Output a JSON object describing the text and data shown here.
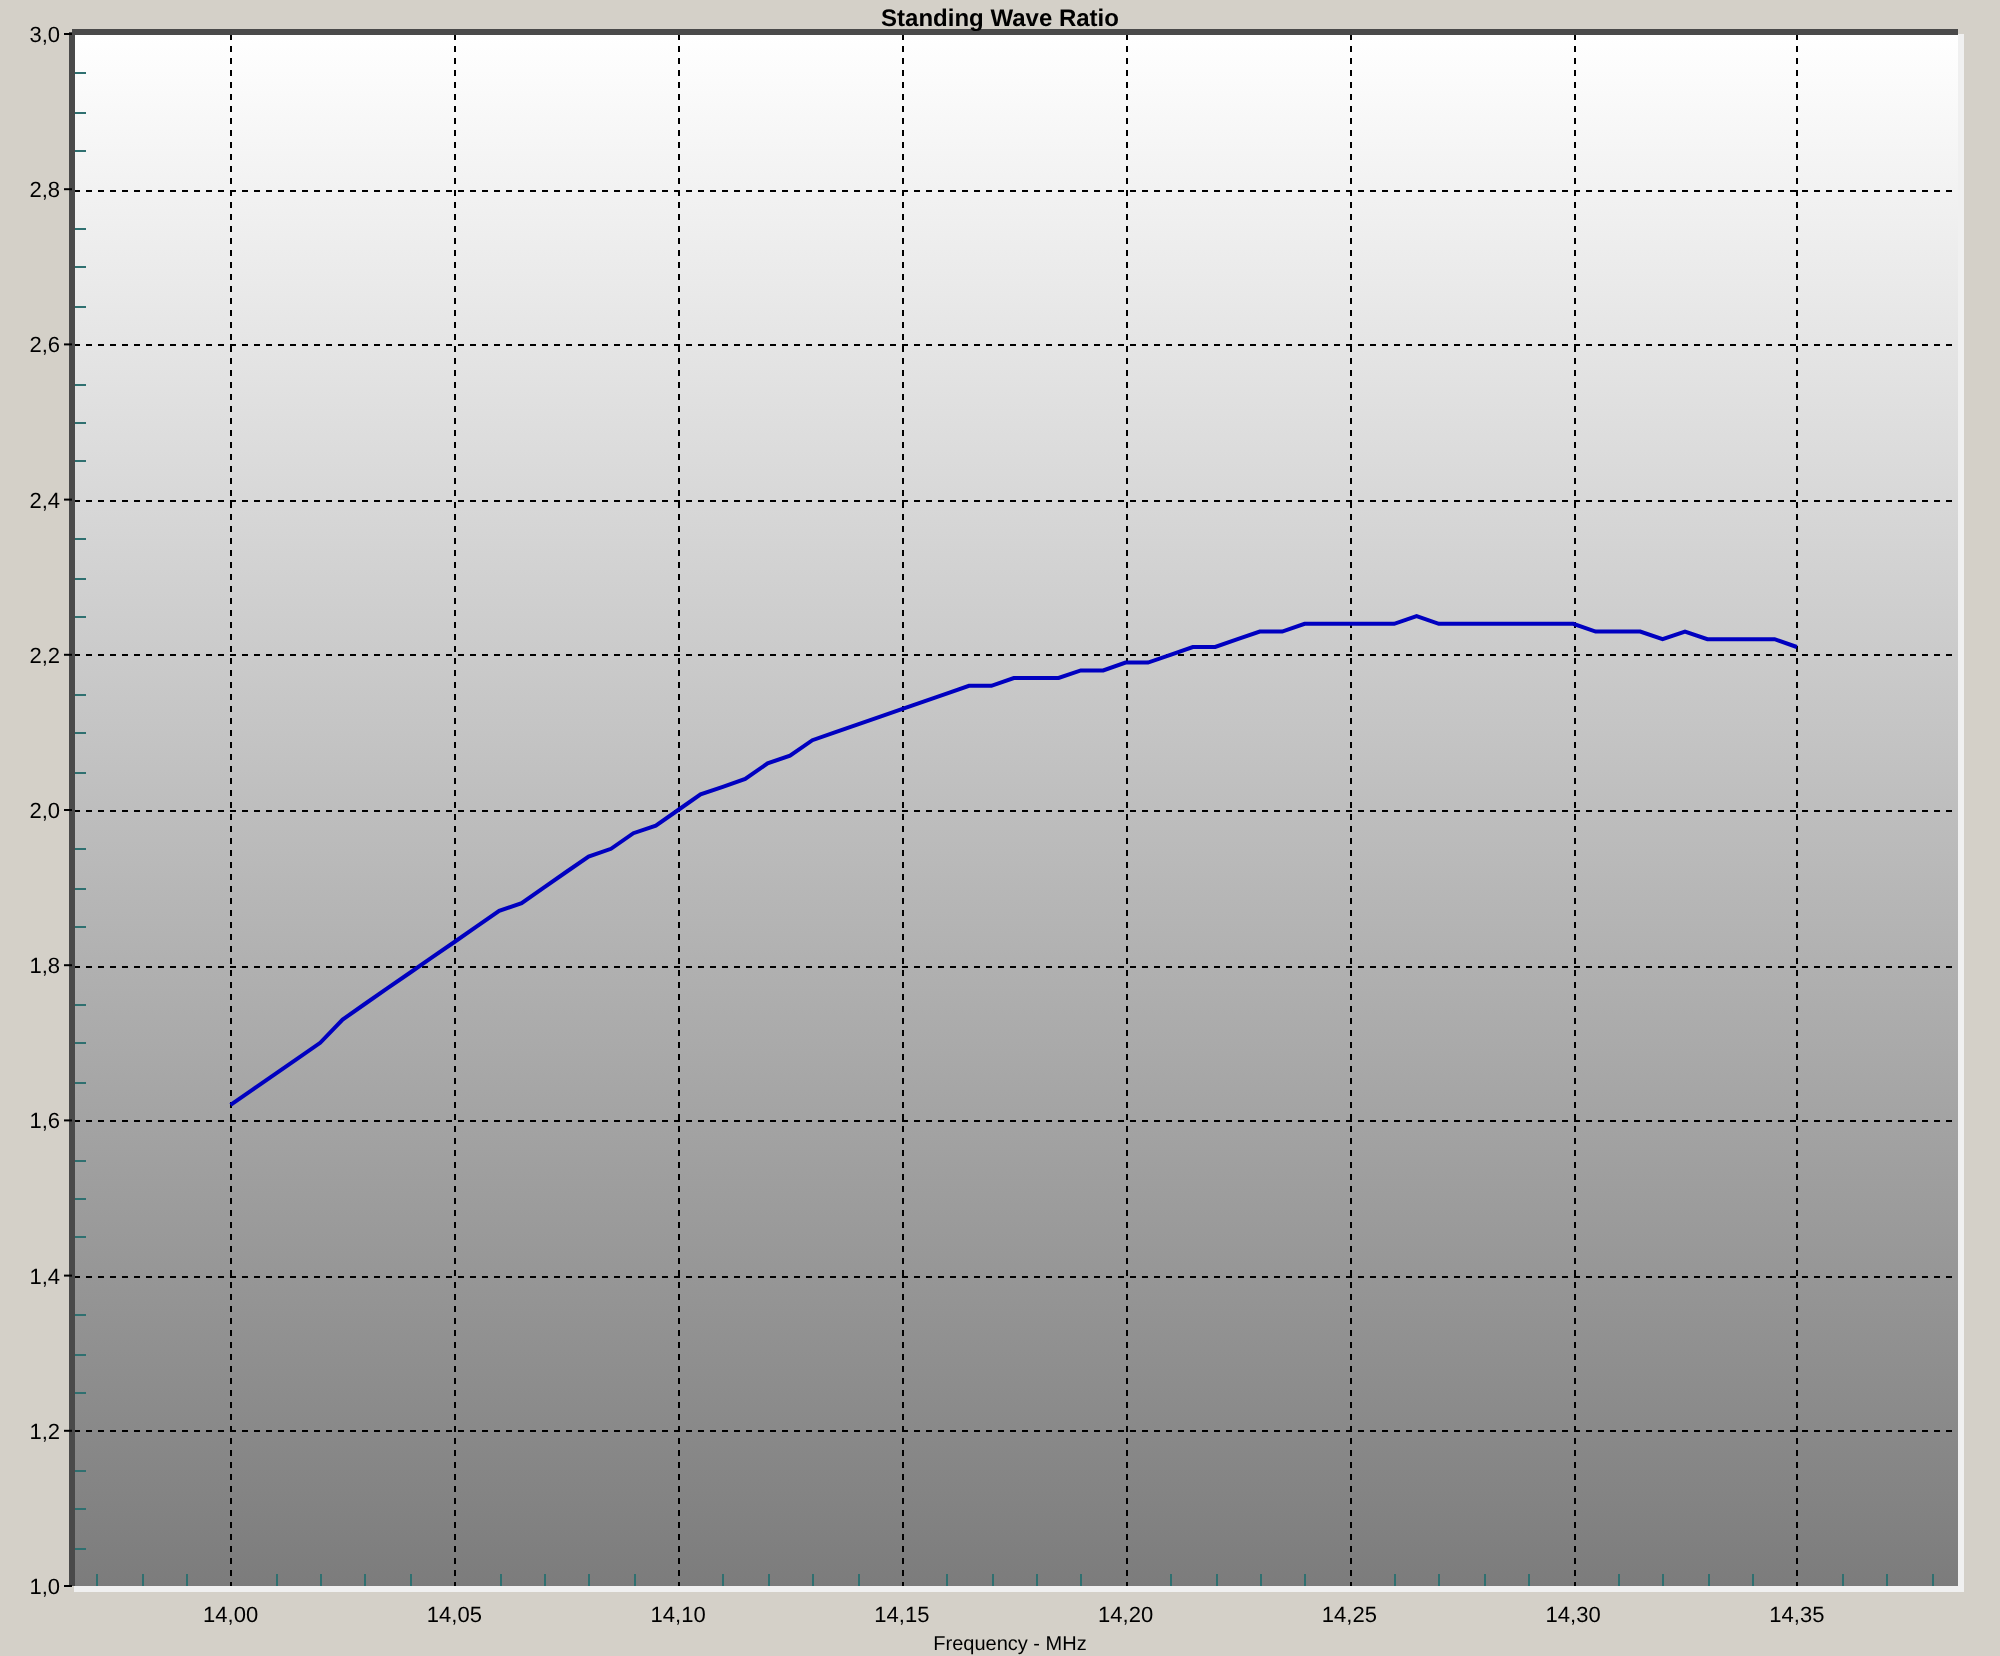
{
  "chart_data": {
    "type": "line",
    "grid": true,
    "title": "Standing Wave Ratio",
    "xlabel": "Frequency - MHz",
    "xlim": [
      13.965,
      14.386
    ],
    "ylim": [
      1.0,
      3.0
    ],
    "xticks": [
      {
        "value": 14.0,
        "label": "14,00"
      },
      {
        "value": 14.05,
        "label": "14,05"
      },
      {
        "value": 14.1,
        "label": "14,10"
      },
      {
        "value": 14.15,
        "label": "14,15"
      },
      {
        "value": 14.2,
        "label": "14,20"
      },
      {
        "value": 14.25,
        "label": "14,25"
      },
      {
        "value": 14.3,
        "label": "14,30"
      },
      {
        "value": 14.35,
        "label": "14,35"
      }
    ],
    "yticks": [
      {
        "value": 1.0,
        "label": "1,0"
      },
      {
        "value": 1.2,
        "label": "1,2"
      },
      {
        "value": 1.4,
        "label": "1,4"
      },
      {
        "value": 1.6,
        "label": "1,6"
      },
      {
        "value": 1.8,
        "label": "1,8"
      },
      {
        "value": 2.0,
        "label": "2,0"
      },
      {
        "value": 2.2,
        "label": "2,2"
      },
      {
        "value": 2.4,
        "label": "2,4"
      },
      {
        "value": 2.6,
        "label": "2,6"
      },
      {
        "value": 2.8,
        "label": "2,8"
      },
      {
        "value": 3.0,
        "label": "3,0"
      }
    ],
    "x": [
      14.0,
      14.005,
      14.01,
      14.015,
      14.02,
      14.025,
      14.03,
      14.035,
      14.04,
      14.045,
      14.05,
      14.055,
      14.06,
      14.065,
      14.07,
      14.075,
      14.08,
      14.085,
      14.09,
      14.095,
      14.1,
      14.105,
      14.11,
      14.115,
      14.12,
      14.125,
      14.13,
      14.135,
      14.14,
      14.145,
      14.15,
      14.155,
      14.16,
      14.165,
      14.17,
      14.175,
      14.18,
      14.185,
      14.19,
      14.195,
      14.2,
      14.205,
      14.21,
      14.215,
      14.22,
      14.225,
      14.23,
      14.235,
      14.24,
      14.245,
      14.25,
      14.255,
      14.26,
      14.265,
      14.27,
      14.275,
      14.28,
      14.285,
      14.29,
      14.295,
      14.3,
      14.305,
      14.31,
      14.315,
      14.32,
      14.325,
      14.33,
      14.335,
      14.34,
      14.345,
      14.35
    ],
    "series": [
      {
        "color": "#0000c0",
        "values": [
          1.62,
          1.64,
          1.66,
          1.68,
          1.7,
          1.73,
          1.75,
          1.77,
          1.79,
          1.81,
          1.83,
          1.85,
          1.87,
          1.88,
          1.9,
          1.92,
          1.94,
          1.95,
          1.97,
          1.98,
          2.0,
          2.02,
          2.03,
          2.04,
          2.06,
          2.07,
          2.09,
          2.1,
          2.11,
          2.12,
          2.13,
          2.14,
          2.15,
          2.16,
          2.16,
          2.17,
          2.17,
          2.17,
          2.18,
          2.18,
          2.19,
          2.19,
          2.2,
          2.21,
          2.21,
          2.22,
          2.23,
          2.23,
          2.24,
          2.24,
          2.24,
          2.24,
          2.24,
          2.25,
          2.24,
          2.24,
          2.24,
          2.24,
          2.24,
          2.24,
          2.24,
          2.23,
          2.23,
          2.23,
          2.22,
          2.23,
          2.22,
          2.22,
          2.22,
          2.22,
          2.21
        ]
      }
    ]
  }
}
